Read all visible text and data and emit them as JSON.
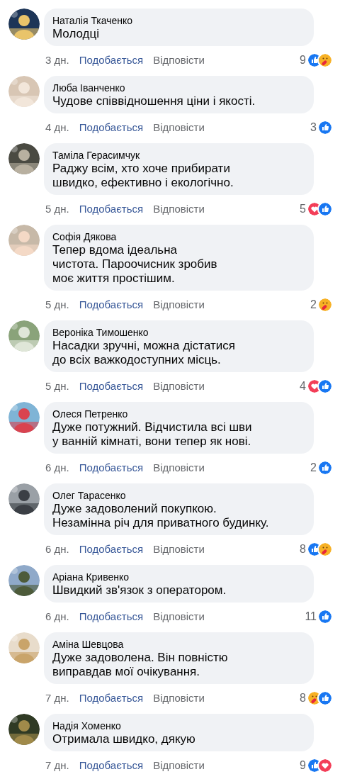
{
  "comments": [
    {
      "name": "Наталія Ткаченко",
      "lines": [
        "Молодці"
      ],
      "time": "3 дн.",
      "like": "Подобається",
      "reply": "Відповісти",
      "count": "9",
      "reactions": [
        {
          "kind": "like"
        },
        {
          "kind": "care"
        }
      ]
    },
    {
      "name": "Люба Іванченко",
      "lines": [
        "Чудове співвідношення ціни і якості."
      ],
      "time": "4 дн.",
      "like": "Подобається",
      "reply": "Відповісти",
      "count": "3",
      "reactions": [
        {
          "kind": "like"
        }
      ]
    },
    {
      "name": "Таміла Герасимчук",
      "lines": [
        "Раджу всім, хто хоче прибирати",
        "швидко, ефективно і екологічно."
      ],
      "time": "5 дн.",
      "like": "Подобається",
      "reply": "Відповісти",
      "count": "5",
      "reactions": [
        {
          "kind": "love"
        },
        {
          "kind": "like"
        }
      ]
    },
    {
      "name": "Софія Дякова",
      "lines": [
        "Тепер вдома ідеальна",
        "чистота. Пароочисник зробив",
        "моє життя простішим."
      ],
      "time": "5 дн.",
      "like": "Подобається",
      "reply": "Відповісти",
      "count": "2",
      "reactions": [
        {
          "kind": "care"
        }
      ]
    },
    {
      "name": "Вероніка Тимошенко",
      "lines": [
        "Насадки зручні, можна дістатися",
        "до всіх важкодоступних місць."
      ],
      "time": "5 дн.",
      "like": "Подобається",
      "reply": "Відповісти",
      "count": "4",
      "reactions": [
        {
          "kind": "love"
        },
        {
          "kind": "like"
        }
      ]
    },
    {
      "name": "Олеся Петренко",
      "lines": [
        "Дуже потужний. Відчистила всі шви",
        "у ванній кімнаті, вони тепер як нові."
      ],
      "time": "6 дн.",
      "like": "Подобається",
      "reply": "Відповісти",
      "count": "2",
      "reactions": [
        {
          "kind": "like"
        }
      ]
    },
    {
      "name": "Олег Тарасенко",
      "lines": [
        "Дуже задоволений покупкою.",
        "Незамінна річ для приватного будинку."
      ],
      "time": "6 дн.",
      "like": "Подобається",
      "reply": "Відповісти",
      "count": "8",
      "reactions": [
        {
          "kind": "like"
        },
        {
          "kind": "care"
        }
      ]
    },
    {
      "name": "Аріана Кривенко",
      "lines": [
        "Швидкий зв'язок з оператором."
      ],
      "time": "6 дн.",
      "like": "Подобається",
      "reply": "Відповісти",
      "count": "11",
      "reactions": [
        {
          "kind": "like"
        }
      ]
    },
    {
      "name": "Аміна Шевцова",
      "lines": [
        "Дуже задоволена. Він повністю",
        "виправдав мої очікування."
      ],
      "time": "7 дн.",
      "like": "Подобається",
      "reply": "Відповісти",
      "count": "8",
      "reactions": [
        {
          "kind": "care"
        },
        {
          "kind": "like"
        }
      ]
    },
    {
      "name": "Надія Хоменко",
      "lines": [
        "Отримала швидко, дякую"
      ],
      "time": "7 дн.",
      "like": "Подобається",
      "reply": "Відповісти",
      "count": "9",
      "reactions": [
        {
          "kind": "like"
        },
        {
          "kind": "love"
        }
      ]
    }
  ]
}
